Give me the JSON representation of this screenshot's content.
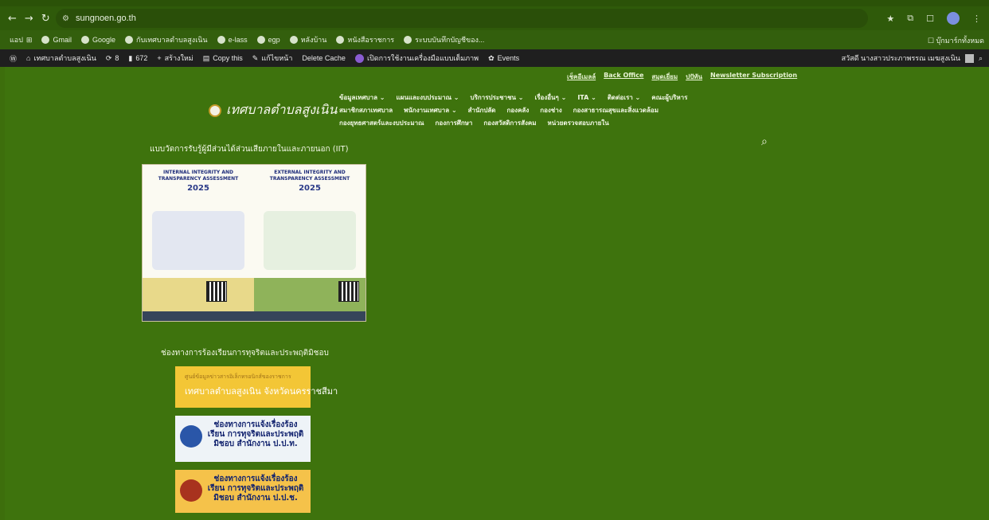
{
  "browser": {
    "url": "sungnoen.go.th",
    "bookmarks": [
      "แอป",
      "Gmail",
      "Google",
      "กับเทศบาลตำบลสูงเนิน",
      "e-lass",
      "egp",
      "หลังบ้าน",
      "หนังสือราชการ",
      "ระบบบันทึกบัญชีของ..."
    ],
    "bookmarks_right": "บุ๊กมาร์กทั้งหมด"
  },
  "wp_admin_bar": {
    "site_name": "เทศบาลตำบลสูงเนิน",
    "updates": "8",
    "comments": "672",
    "new_label": "สร้างใหม่",
    "copy_label": "Copy this",
    "edit_label": "แก้ไขหน้า",
    "cache_label": "Delete Cache",
    "accessibility_label": "เปิดการใช้งานเครื่องมือแบบเต็มภาพ",
    "events_label": "Events",
    "greeting": "สวัสดี นางสาวประภาพรรณ เมฆสูงเนิน"
  },
  "site": {
    "top_links": [
      "เช็คอีเมลล์",
      "Back Office",
      "สมุดเยี่ยม",
      "ปปัทัน",
      "Newsletter Subscription"
    ],
    "logo_text": "เทศบาลตำบลสูงเนิน",
    "menu_row1": [
      "ข้อมูลเทศบาล ⌄",
      "แผนและงบประมาณ ⌄",
      "บริการประชาชน ⌄",
      "เรื่องอื่นๆ ⌄",
      "ITA ⌄",
      "ติดต่อเรา ⌄",
      "คณะผู้บริหาร"
    ],
    "menu_row2": [
      "สมาชิกสภาเทศบาล",
      "พนักงานเทศบาล ⌄",
      "สำนักปลัด",
      "กองคลัง",
      "กองช่าง",
      "กองสาธารณสุขและสิ่งแวดล้อม"
    ],
    "menu_row3": [
      "กองยุทธศาสตร์และงบประมาณ",
      "กองการศึกษา",
      "กองสวัสดิการสังคม",
      "หน่วยตรวจสอบภายใน"
    ],
    "iit_title": "แบบวัดการรับรู้ผู้มีส่วนได้ส่วนเสียภายในและภายนอก (IIT)",
    "banner_left_title": "INTERNAL INTEGRITY AND TRANSPARENCY ASSESSMENT",
    "banner_right_title": "EXTERNAL INTEGRITY AND TRANSPARENCY ASSESSMENT",
    "banner_year": "2025",
    "complaint_title": "ช่องทางการร้องเรียนการทุจริตและประพฤติมิชอบ",
    "box1_line1": "ศูนย์ข้อมูลข่าวสารอิเล็กทรอนิกส์ของราชการ",
    "box1_line2": "เทศบาลตำบลสูงเนิน จังหวัดนครราชสีมา",
    "box2_text": "ช่องทางการแจ้งเรื่องร้องเรียน การทุจริตและประพฤติมิชอบ สำนักงาน ป.ป.ท.",
    "box3_text": "ช่องทางการแจ้งเรื่องร้องเรียน การทุจริตและประพฤติมิชอบ สำนักงาน ป.ป.ช."
  }
}
